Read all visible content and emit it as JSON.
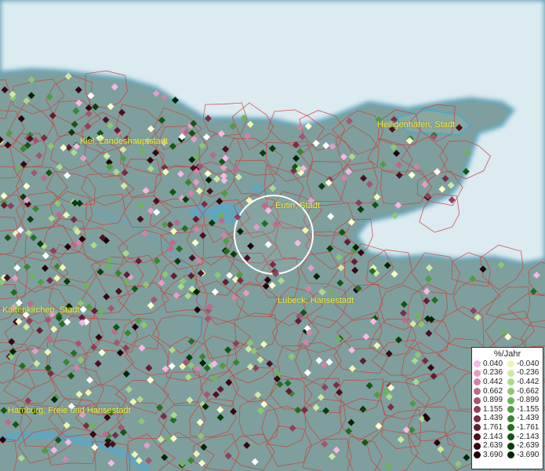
{
  "cities": [
    {
      "name": "Kiel, Landeshauptstadt"
    },
    {
      "name": "Heiligenhafen, Stadt"
    },
    {
      "name": "Eutin, Stadt"
    },
    {
      "name": "Lübeck, Hansestadt"
    },
    {
      "name": "Kaltenkirchen, Stadt"
    },
    {
      "name": "Hamburg, Freie und Hansestadt"
    }
  ],
  "legend": {
    "title": "%/Jahr",
    "positive": [
      {
        "label": "0.040",
        "color": "#f6b8e4"
      },
      {
        "label": "0.236",
        "color": "#e39ec6"
      },
      {
        "label": "0.442",
        "color": "#cf84a8"
      },
      {
        "label": "0.662",
        "color": "#b96c8c"
      },
      {
        "label": "0.899",
        "color": "#a35572"
      },
      {
        "label": "1.155",
        "color": "#8e405b"
      },
      {
        "label": "1.439",
        "color": "#782d46"
      },
      {
        "label": "1.761",
        "color": "#631d33"
      },
      {
        "label": "2.143",
        "color": "#4d1022"
      },
      {
        "label": "2.639",
        "color": "#370714"
      },
      {
        "label": "3.690",
        "color": "#210108"
      }
    ],
    "negative": [
      {
        "label": "-0.040",
        "color": "#eef7b2"
      },
      {
        "label": "-0.236",
        "color": "#cfe9a4"
      },
      {
        "label": "-0.442",
        "color": "#acd98c"
      },
      {
        "label": "-0.662",
        "color": "#8cc874"
      },
      {
        "label": "-0.899",
        "color": "#6db35c"
      },
      {
        "label": "-1.155",
        "color": "#509c45"
      },
      {
        "label": "-1.439",
        "color": "#388532"
      },
      {
        "label": "-1.761",
        "color": "#246d22"
      },
      {
        "label": "-2.143",
        "color": "#155515"
      },
      {
        "label": "-2.639",
        "color": "#093d0b"
      },
      {
        "label": "-3.690",
        "color": "#022604"
      }
    ]
  },
  "colors": {
    "sea": "#dcebf0",
    "land": "#7e9f9d",
    "boundary": "#c8413c",
    "label": "#f2ea3a"
  }
}
